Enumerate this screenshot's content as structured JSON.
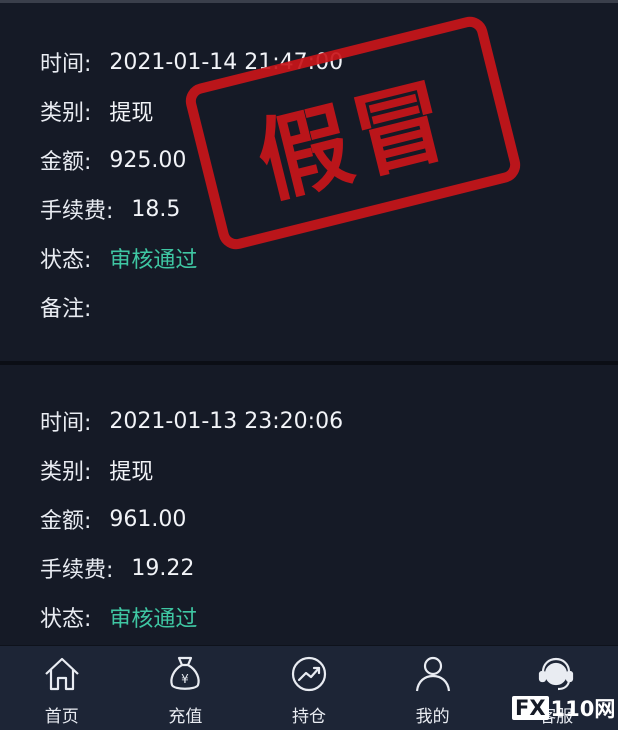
{
  "records": [
    {
      "time_label": "时间:",
      "time_value": "2021-01-14 21:47:00",
      "type_label": "类别:",
      "type_value": "提现",
      "amount_label": "金额:",
      "amount_value": "925.00",
      "fee_label": "手续费:",
      "fee_value": "18.5",
      "status_label": "状态:",
      "status_value": "审核通过",
      "note_label": "备注:",
      "note_value": ""
    },
    {
      "time_label": "时间:",
      "time_value": "2021-01-13 23:20:06",
      "type_label": "类别:",
      "type_value": "提现",
      "amount_label": "金额:",
      "amount_value": "961.00",
      "fee_label": "手续费:",
      "fee_value": "19.22",
      "status_label": "状态:",
      "status_value": "审核通过"
    }
  ],
  "stamp": {
    "text": "假冒",
    "color": "#c9151a"
  },
  "tabbar": {
    "items": [
      {
        "label": "首页",
        "icon": "home-icon"
      },
      {
        "label": "充值",
        "icon": "money-bag-icon"
      },
      {
        "label": "持仓",
        "icon": "trend-chart-icon"
      },
      {
        "label": "我的",
        "icon": "user-icon"
      },
      {
        "label": "客服",
        "icon": "headset-icon"
      }
    ]
  },
  "watermark": {
    "box_text": "FX",
    "rest_text": "110网"
  },
  "colors": {
    "background": "#151a26",
    "status": "#3fc7a3",
    "tabbar": "#1d2536"
  }
}
